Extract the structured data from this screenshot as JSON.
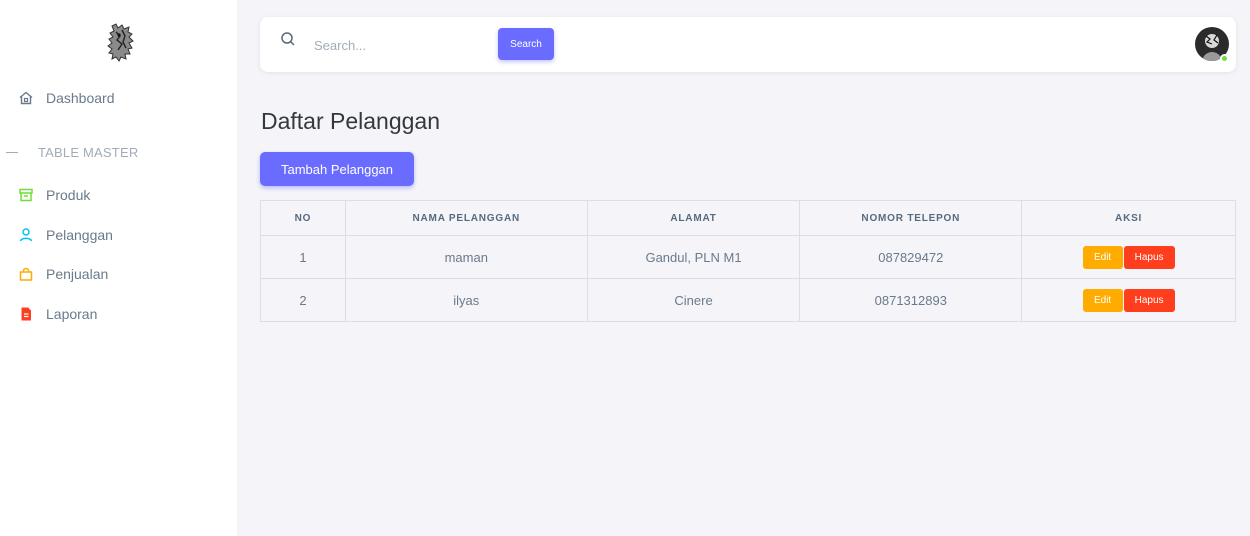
{
  "sidebar": {
    "logo_icon": "mascot-logo",
    "items": [
      {
        "label": "Dashboard",
        "icon": "home-icon"
      },
      {
        "label": "Produk",
        "icon": "archive-icon",
        "color": "#71dd37"
      },
      {
        "label": "Pelanggan",
        "icon": "user-icon",
        "color": "#03c3ec"
      },
      {
        "label": "Penjualan",
        "icon": "shopping-bag-icon",
        "color": "#ffab00"
      },
      {
        "label": "Laporan",
        "icon": "file-icon",
        "color": "#ff3e1d"
      }
    ],
    "section_label": "TABLE MASTER"
  },
  "topbar": {
    "search_placeholder": "Search...",
    "search_button": "Search"
  },
  "page": {
    "title": "Daftar Pelanggan",
    "add_button": "Tambah Pelanggan"
  },
  "table": {
    "headers": [
      "NO",
      "NAMA PELANGGAN",
      "ALAMAT",
      "NOMOR TELEPON",
      "AKSI"
    ],
    "rows": [
      {
        "no": "1",
        "nama": "maman",
        "alamat": "Gandul, PLN M1",
        "telepon": "087829472",
        "edit": "Edit",
        "hapus": "Hapus"
      },
      {
        "no": "2",
        "nama": "ilyas",
        "alamat": "Cinere",
        "telepon": "0871312893",
        "edit": "Edit",
        "hapus": "Hapus"
      }
    ]
  },
  "colors": {
    "primary": "#696cff",
    "warning": "#ffab00",
    "danger": "#ff3e1d",
    "online": "#71dd37"
  }
}
